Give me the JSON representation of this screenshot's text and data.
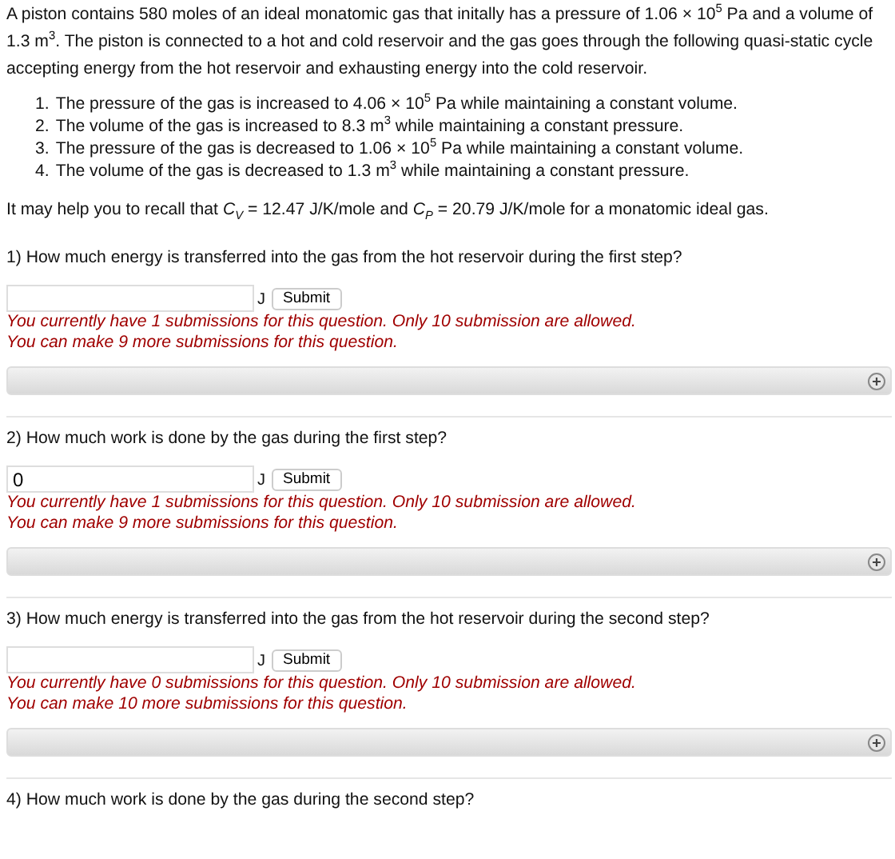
{
  "intro": "A piston contains 580 moles of an ideal monatomic gas that initally has a pressure of 1.06 × 10$^{5}$ Pa and a volume of 1.3 m$^{3}$. The piston is connected to a hot and cold reservoir and the gas goes through the following quasi-static cycle accepting energy from the hot reservoir and exhausting energy into the cold reservoir.",
  "steps": [
    "The pressure of the gas is increased to 4.06 × 10$^{5}$ Pa while maintaining a constant volume.",
    "The volume of the gas is increased to 8.3 m$^{3}$ while maintaining a constant pressure.",
    "The pressure of the gas is decreased to 1.06 × 10$^{5}$ Pa while maintaining a constant volume.",
    "The volume of the gas is decreased to 1.3 m$^{3}$ while maintaining a constant pressure."
  ],
  "step_numbers": [
    "1.",
    "2.",
    "3.",
    "4."
  ],
  "recall": "It may help you to recall that *C*$_{V}$ = 12.47 J/K/mole and *C*$_{P}$ = 20.79 J/K/mole for a monatomic ideal gas.",
  "questions": [
    {
      "text": "1) How much energy is transferred into the gas from the hot reservoir during the first step?",
      "unit": "J",
      "button": "Submit",
      "messages": [
        "You currently have 1 submissions for this question. Only 10 submission are allowed.",
        "You can make 9 more submissions for this question."
      ]
    },
    {
      "text": "2) How much work is done by the gas during the first step?",
      "value": "0",
      "unit": "J",
      "button": "Submit",
      "messages": [
        "You currently have 1 submissions for this question. Only 10 submission are allowed.",
        "You can make 9 more submissions for this question."
      ]
    },
    {
      "text": "3) How much energy is transferred into the gas from the hot reservoir during the second step?",
      "unit": "J",
      "button": "Submit",
      "messages": [
        "You currently have 0 submissions for this question. Only 10 submission are allowed.",
        "You can make 10 more submissions for this question."
      ]
    },
    {
      "text": "4) How much work is done by the gas during the second step?"
    }
  ]
}
